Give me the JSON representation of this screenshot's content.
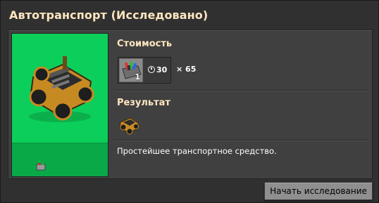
{
  "window": {
    "title": "Автотранспорт (Исследовано)"
  },
  "cost": {
    "heading": "Стоимость",
    "pack_icon": "automation-science-pack-icon",
    "pack_count": "1",
    "time": "30",
    "multiplier": "× 65"
  },
  "result": {
    "heading": "Результат",
    "icon": "car-icon"
  },
  "description": "Простейшее транспортное средство.",
  "actions": {
    "start_research": "Начать исследование"
  },
  "colors": {
    "preview_green": "#0bcf5a",
    "title": "#ffe6c0",
    "button": "#8f8f8f"
  }
}
